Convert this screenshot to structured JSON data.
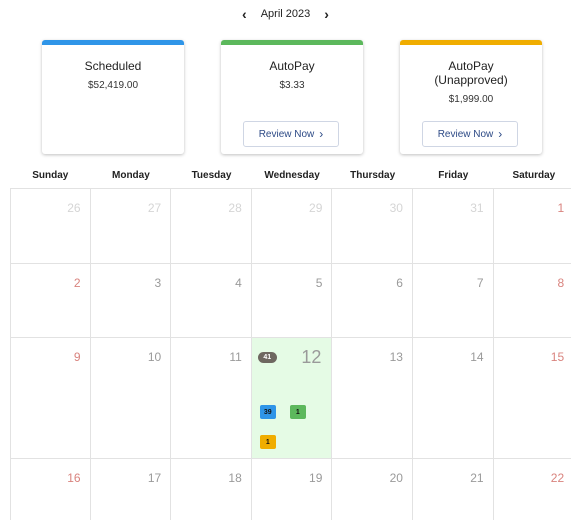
{
  "header": {
    "prev_icon": "chevron-left-icon",
    "next_icon": "chevron-right-icon",
    "month": "April 2023"
  },
  "cards": [
    {
      "title": "Scheduled",
      "amount": "$52,419.00",
      "color": "#2f95e8"
    },
    {
      "title": "AutoPay",
      "amount": "$3.33",
      "color": "#5cb85c",
      "button": "Review Now"
    },
    {
      "title": "AutoPay (Unapproved)",
      "amount": "$1,999.00",
      "color": "#f0ad00",
      "button": "Review Now"
    }
  ],
  "weekdays": [
    "Sunday",
    "Monday",
    "Tuesday",
    "Wednesday",
    "Thursday",
    "Friday",
    "Saturday"
  ],
  "weeks": [
    [
      "26",
      "27",
      "28",
      "29",
      "30",
      "31",
      "1"
    ],
    [
      "2",
      "3",
      "4",
      "5",
      "6",
      "7",
      "8"
    ],
    [
      "9",
      "10",
      "11",
      "12",
      "13",
      "14",
      "15"
    ],
    [
      "16",
      "17",
      "18",
      "19",
      "20",
      "21",
      "22"
    ]
  ],
  "today": {
    "total": "41",
    "badges": [
      {
        "count": "39",
        "color": "#2f95e8"
      },
      {
        "count": "1",
        "color": "#5cb85c"
      },
      {
        "count": "1",
        "color": "#f0ad00"
      }
    ]
  }
}
